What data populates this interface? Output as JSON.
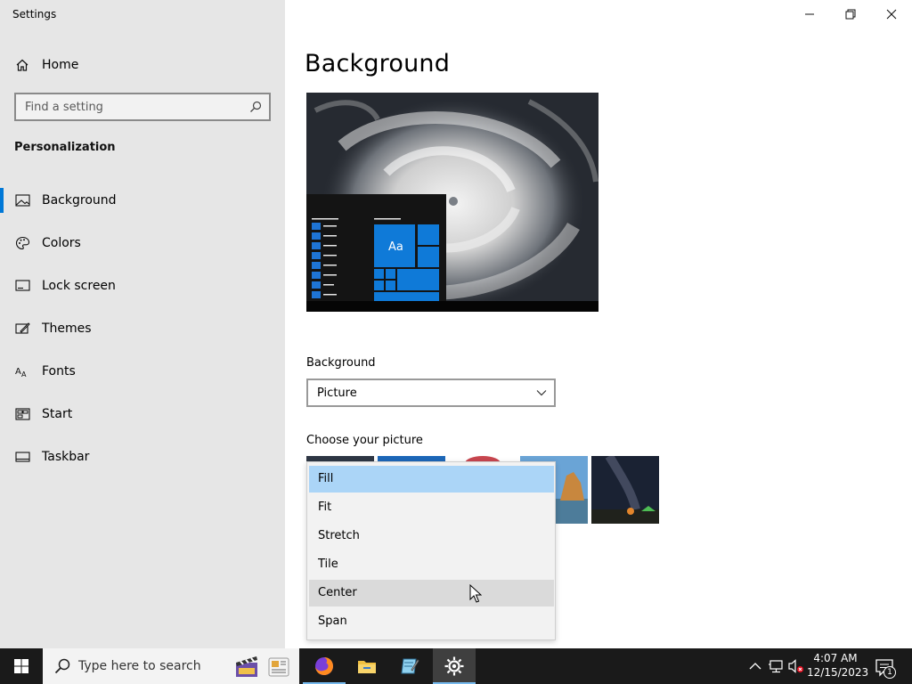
{
  "window": {
    "title": "Settings",
    "controls": [
      "minimize-icon",
      "restore-icon",
      "close-icon"
    ]
  },
  "sidebar": {
    "home_label": "Home",
    "search_placeholder": "Find a setting",
    "section_title": "Personalization",
    "items": [
      {
        "label": "Background",
        "icon": "picture-icon",
        "selected": true
      },
      {
        "label": "Colors",
        "icon": "palette-icon",
        "selected": false
      },
      {
        "label": "Lock screen",
        "icon": "lock-screen-icon",
        "selected": false
      },
      {
        "label": "Themes",
        "icon": "themes-icon",
        "selected": false
      },
      {
        "label": "Fonts",
        "icon": "fonts-icon",
        "selected": false
      },
      {
        "label": "Start",
        "icon": "start-icon",
        "selected": false
      },
      {
        "label": "Taskbar",
        "icon": "taskbar-icon",
        "selected": false
      }
    ]
  },
  "main": {
    "title": "Background",
    "preview_tile_label": "Aa",
    "background_label": "Background",
    "background_value": "Picture",
    "choose_picture_label": "Choose your picture"
  },
  "fit_dropdown": {
    "options": [
      "Fill",
      "Fit",
      "Stretch",
      "Tile",
      "Center",
      "Span"
    ],
    "selected": "Fill",
    "hovered": "Center"
  },
  "taskbar": {
    "search_text": "Type here to search",
    "apps": [
      "firefox-icon",
      "file-explorer-icon",
      "notepad-icon",
      "settings-icon"
    ],
    "active_app": "settings-icon",
    "clock_time": "4:07 AM",
    "clock_date": "12/15/2023",
    "notification_count": "1"
  },
  "colors": {
    "accent": "#0078d7",
    "sidebar_bg": "#e6e6e6",
    "dropdown_selected": "#abd5f7",
    "dropdown_hover": "#dadada",
    "taskbar_bg": "#1a1a1a"
  }
}
